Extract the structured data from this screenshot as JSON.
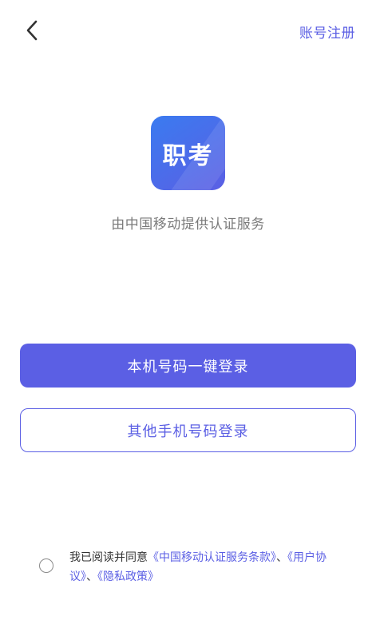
{
  "header": {
    "back_icon": "chevron-left-icon",
    "register_label": "账号注册"
  },
  "logo": {
    "text": "职考"
  },
  "provider_text": "由中国移动提供认证服务",
  "buttons": {
    "one_click_login": "本机号码一键登录",
    "other_phone_login": "其他手机号码登录"
  },
  "agreement": {
    "prefix": "我已阅读并同意",
    "cmcc_terms": "《中国移动认证服务条款》",
    "sep1": "、",
    "user_agreement": "《用户协议》",
    "sep2": "、",
    "privacy_policy": "《隐私政策》",
    "checked": false
  },
  "colors": {
    "accent": "#5b5fe4",
    "text_gray": "#7a7a7a"
  }
}
